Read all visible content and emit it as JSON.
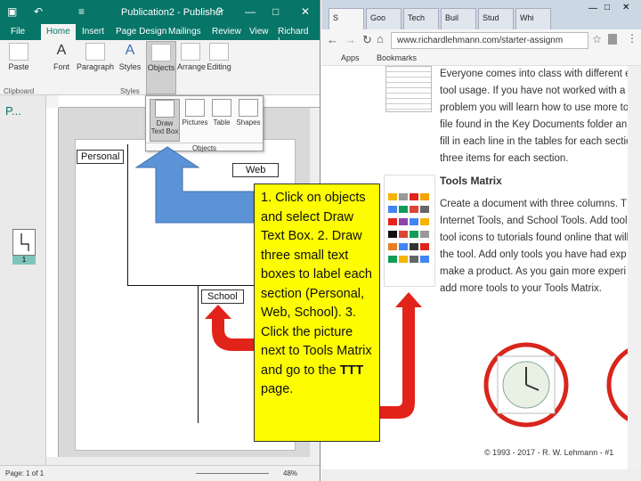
{
  "publisher": {
    "title": "Publication2 - Publisher",
    "user": "Richard L...",
    "window_buttons": [
      "?",
      "—",
      "□",
      "✕"
    ],
    "tabs": [
      "File",
      "Home",
      "Insert",
      "Page Design",
      "Mailings",
      "Review",
      "View"
    ],
    "ribbon": {
      "paste": "Paste",
      "font": "Font",
      "paragraph": "Paragraph",
      "styles": "Styles",
      "objects": "Objects",
      "arrange": "Arrange",
      "editing": "Editing",
      "group_clipboard": "Clipboard",
      "group_styles": "Styles"
    },
    "objects_menu": {
      "items": [
        "Draw Text Box",
        "Pictures",
        "Table",
        "Shapes"
      ],
      "caption": "Objects"
    },
    "pages_label": "P...",
    "page_number": "1",
    "labels": [
      "Personal",
      "Web",
      "School"
    ],
    "status": {
      "page": "Page: 1 of 1",
      "zoom": "48%"
    }
  },
  "browser": {
    "tabs": [
      "S",
      "Goo",
      "Tech",
      "Buil",
      "Stud",
      "Whi"
    ],
    "url": "www.richardlehmann.com/starter-assignm",
    "bookmarks": [
      "Apps",
      "Bookmarks"
    ],
    "content": {
      "intro_lines": [
        "Everyone comes into class with different e",
        "tool usage. If you have not worked with a",
        "problem you will learn how to use more to",
        "file found in the Key Documents folder an",
        "fill in each line in the tables for each sectio",
        "three items for each section."
      ],
      "heading": "Tools Matrix",
      "body_lines": [
        "Create a document with three columns. T",
        "Internet Tools, and School Tools. Add tool",
        "tool icons to tutorials found online that will",
        "the tool. Add only tools you have had exp",
        "make a product. As you gain more experi",
        "add more tools to your Tools Matrix."
      ],
      "footer": "© 1993 - 2017 - R. W. Lehmann - #1"
    }
  },
  "callout": {
    "text_before_bold": "1. Click on objects and select Draw Text Box. 2. Draw three small text boxes to label each section (Personal, Web, School). 3. Click the picture next to Tools Matrix and go to the",
    "bold": "TTT",
    "text_after_bold": "page."
  },
  "colors": {
    "publisher_green": "#077568",
    "callout_yellow": "#fdfc00",
    "arrow_red": "#e2231a",
    "arrow_blue": "#5b93d6"
  }
}
